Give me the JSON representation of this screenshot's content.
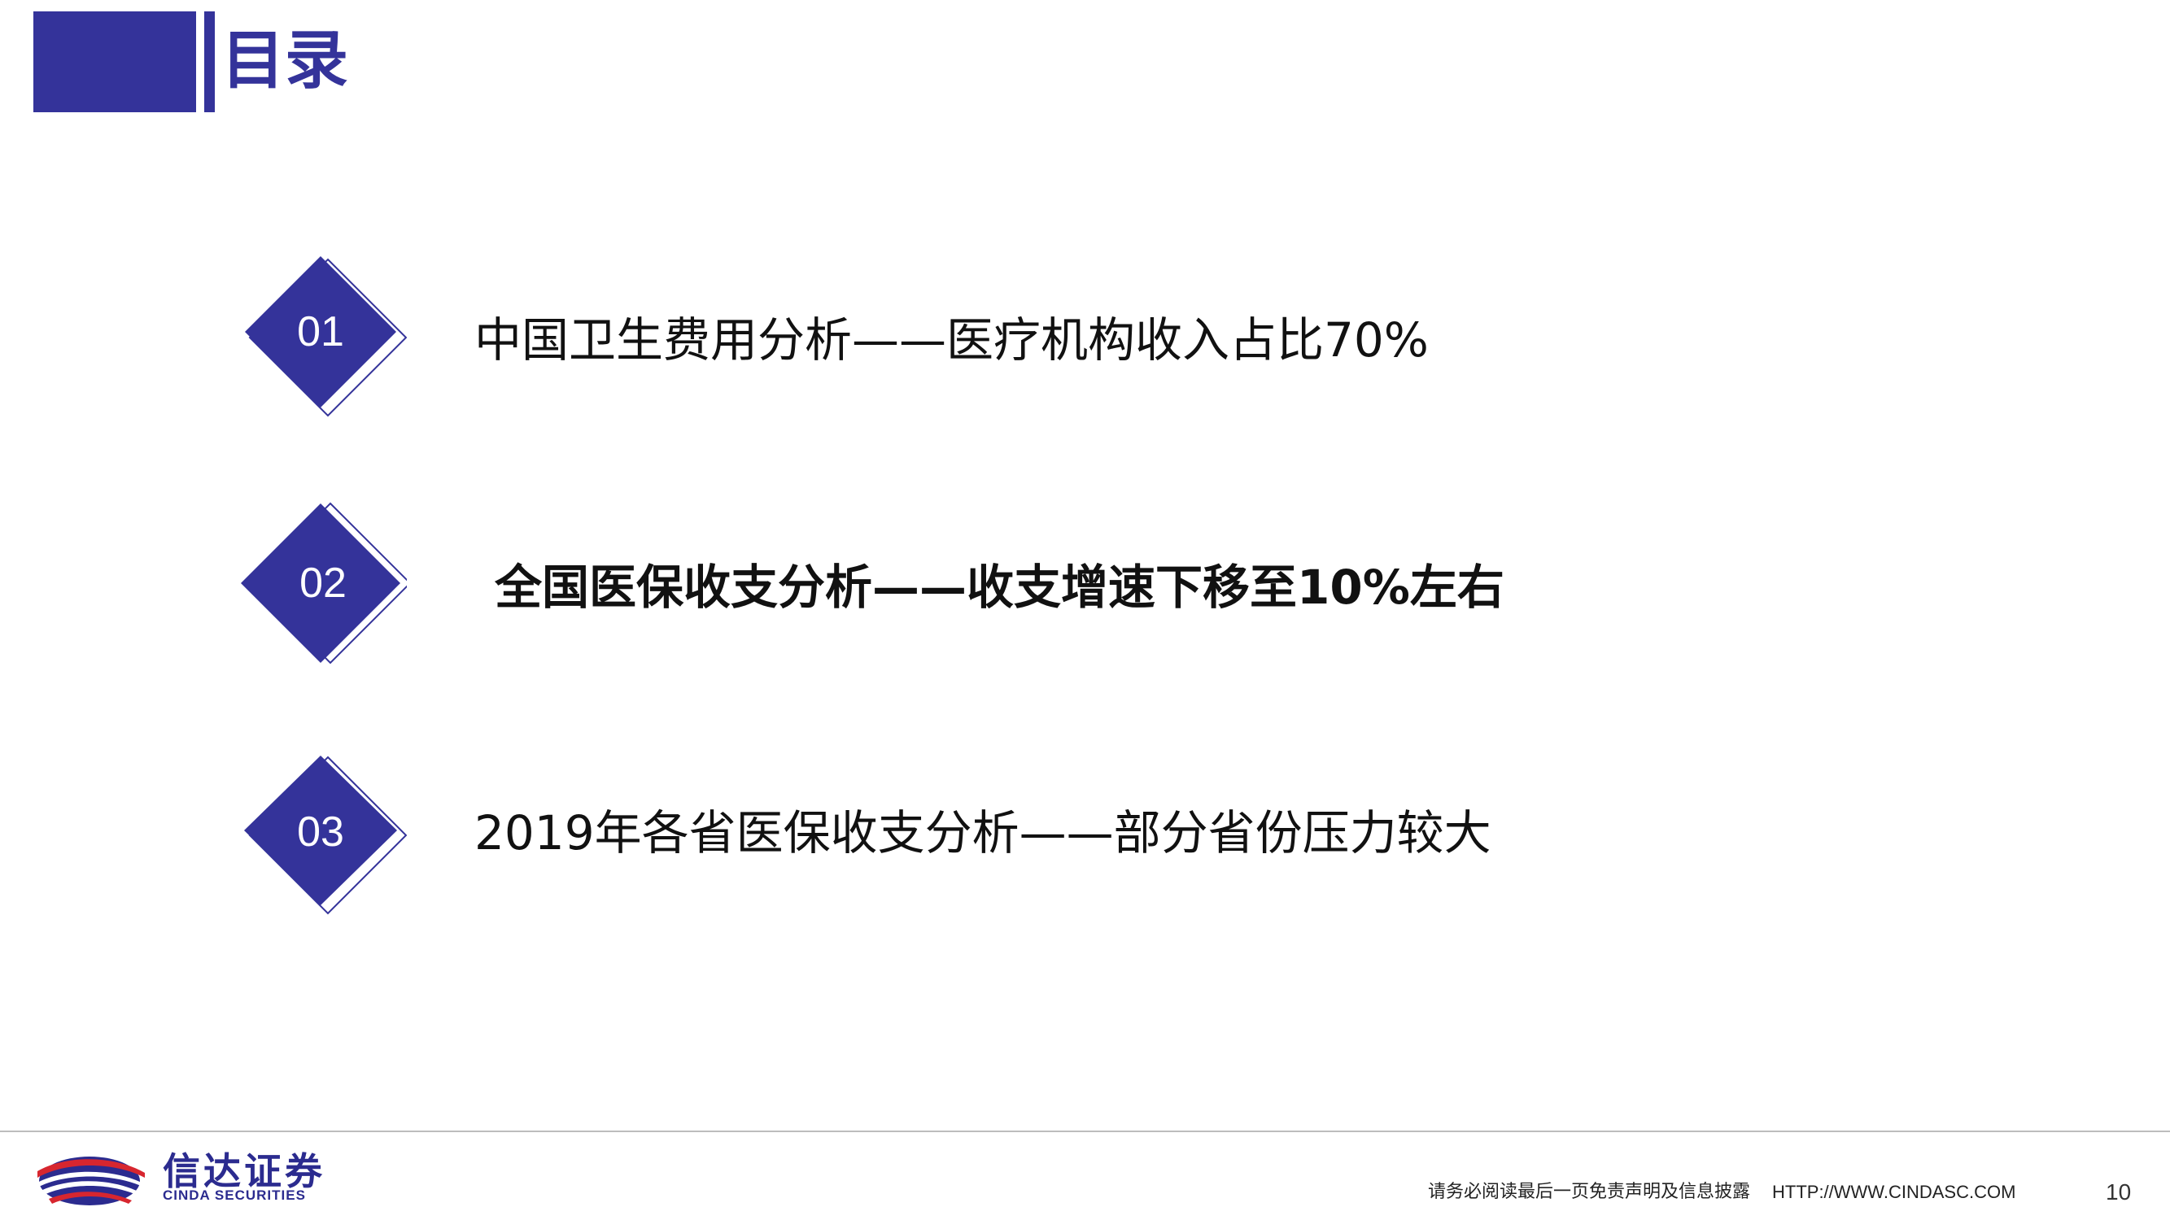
{
  "header": {
    "title": "目录",
    "accent_color": "#34339a"
  },
  "toc": [
    {
      "number": "01",
      "text": "中国卫生费用分析——医疗机构收入占比70%",
      "bold": false
    },
    {
      "number": "02",
      "text": "全国医保收支分析——收支增速下移至10%左右",
      "bold": true
    },
    {
      "number": "03",
      "text": "2019年各省医保收支分析——部分省份压力较大",
      "bold": false
    }
  ],
  "footer": {
    "logo_cn": "信达证券",
    "logo_en": "CINDA SECURITIES",
    "disclaimer": "请务必阅读最后一页免责声明及信息披露",
    "url": "HTTP://WWW.CINDASC.COM",
    "page_number": "10",
    "logo_colors": {
      "red": "#d7262f",
      "blue": "#2b2b8f"
    }
  }
}
